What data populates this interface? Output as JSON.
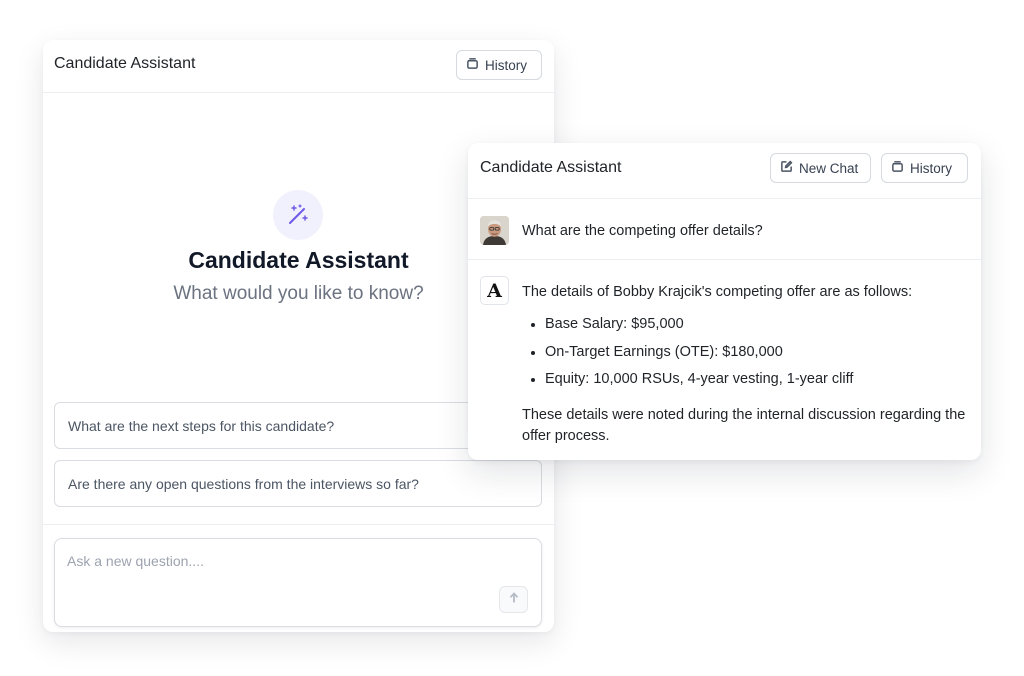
{
  "left_panel": {
    "title": "Candidate Assistant",
    "history_label": "History",
    "hero_title": "Candidate Assistant",
    "hero_subtitle": "What would you like to know?",
    "suggestions": [
      "What are the next steps for this candidate?",
      "Are there any open questions from the interviews so far?"
    ],
    "composer_placeholder": "Ask a new question...."
  },
  "right_panel": {
    "title": "Candidate Assistant",
    "new_chat_label": "New Chat",
    "history_label": "History",
    "user_message": "What are the competing offer details?",
    "assistant_badge": "A",
    "assistant_intro": "The details of Bobby Krajcik's competing offer are as follows:",
    "assistant_items": [
      "Base Salary: $95,000",
      "On-Target Earnings (OTE): $180,000",
      "Equity: 10,000 RSUs, 4-year vesting, 1-year cliff"
    ],
    "assistant_outro": "These details were noted during the internal discussion regarding the offer process."
  },
  "icons": {
    "history": "history-icon",
    "new_chat": "edit-icon",
    "hero": "magic-wand-icon",
    "send": "arrow-up-icon"
  },
  "colors": {
    "accent": "#6d5ae6",
    "accent_bg": "#f1f0fd",
    "border": "#d9dce1",
    "muted_text": "#6b7280"
  }
}
